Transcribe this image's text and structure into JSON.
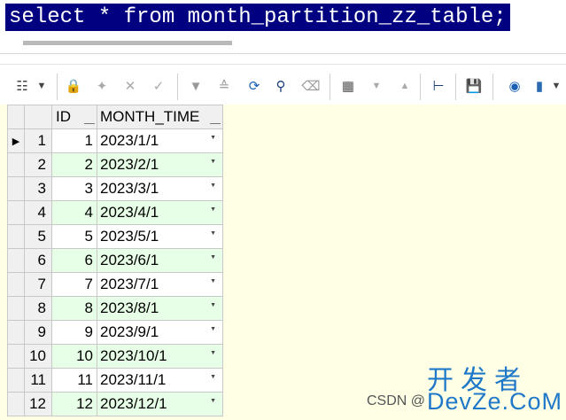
{
  "editor": {
    "sql": "select * from month_partition_zz_table;"
  },
  "toolbar": {
    "icons": [
      "grid-options-icon",
      "dropdown-icon",
      "lock-icon",
      "insert-row-icon",
      "delete-row-icon",
      "post-edit-icon",
      "first-record-icon",
      "last-record-icon",
      "refresh-icon",
      "find-icon",
      "clear-icon",
      "record-view-icon",
      "move-down-icon",
      "move-up-icon",
      "link-icon",
      "save-icon",
      "database-info-icon",
      "chart-icon",
      "chart-dropdown-icon"
    ]
  },
  "grid": {
    "columns": [
      "ID",
      "MONTH_TIME"
    ],
    "rows": [
      {
        "num": "1",
        "id": "1",
        "month_time": "2023/1/1"
      },
      {
        "num": "2",
        "id": "2",
        "month_time": "2023/2/1"
      },
      {
        "num": "3",
        "id": "3",
        "month_time": "2023/3/1"
      },
      {
        "num": "4",
        "id": "4",
        "month_time": "2023/4/1"
      },
      {
        "num": "5",
        "id": "5",
        "month_time": "2023/5/1"
      },
      {
        "num": "6",
        "id": "6",
        "month_time": "2023/6/1"
      },
      {
        "num": "7",
        "id": "7",
        "month_time": "2023/7/1"
      },
      {
        "num": "8",
        "id": "8",
        "month_time": "2023/8/1"
      },
      {
        "num": "9",
        "id": "9",
        "month_time": "2023/9/1"
      },
      {
        "num": "10",
        "id": "10",
        "month_time": "2023/10/1"
      },
      {
        "num": "11",
        "id": "11",
        "month_time": "2023/11/1"
      },
      {
        "num": "12",
        "id": "12",
        "month_time": "2023/12/1"
      }
    ],
    "current_row_marker": "▶"
  },
  "watermark": {
    "csdn": "CSDN @",
    "cn": "开发者",
    "en": "DevZe.CoM"
  },
  "colors": {
    "sql_selection_bg": "#000080",
    "grid_bg": "#ffffe6",
    "alt_row_bg": "#e6ffe6",
    "watermark": "#1f78c8"
  }
}
